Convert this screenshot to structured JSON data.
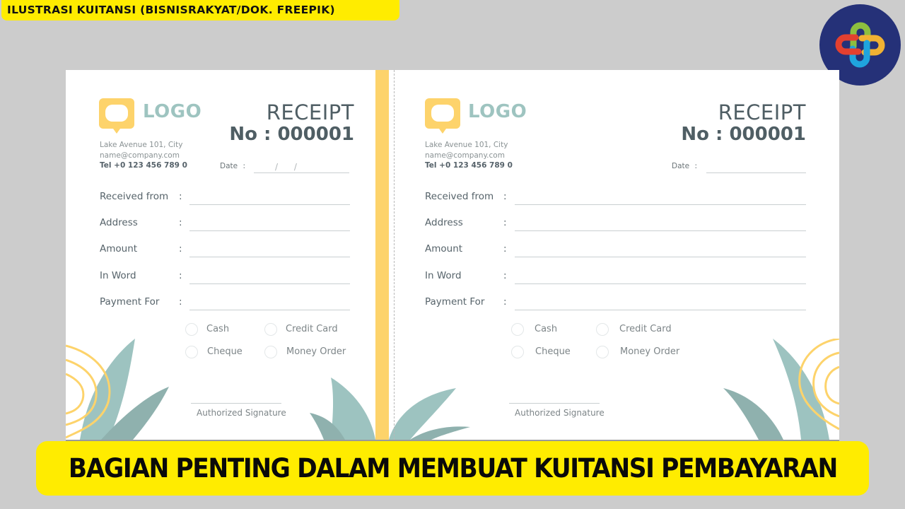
{
  "caption": "ILUSTRASI KUITANSI (BISNISRAKYAT/DOK. FREEPIK)",
  "headline": "BAGIAN PENTING DALAM MEMBUAT KUITANSI PEMBAYARAN",
  "brand_logo": {
    "icon": "interlocking-chain-logo",
    "colors": [
      "#253178",
      "#8dbf3f",
      "#f1b233",
      "#1fa4de",
      "#e3402f"
    ]
  },
  "colors": {
    "accent_yellow": "#fdd36b",
    "logo_teal": "#9ec4c0",
    "text_dark": "#4f5e64",
    "leaf": "#9dc3c0"
  },
  "receipts": [
    {
      "logo_text": "LOGO",
      "address": "Lake Avenue 101, City",
      "email": "name@company.com",
      "tel": "Tel +0 123 456 789 0",
      "title": "RECEIPT",
      "number": "No : 000001",
      "date_label": "Date",
      "date_sep": ":",
      "date_value": "/      /",
      "fields": [
        {
          "label": "Received from",
          "colon": ":",
          "value": ""
        },
        {
          "label": "Address",
          "colon": ":",
          "value": ""
        },
        {
          "label": "Amount",
          "colon": ":",
          "value": ""
        },
        {
          "label": "In Word",
          "colon": ":",
          "value": ""
        },
        {
          "label": "Payment For",
          "colon": ":",
          "value": ""
        }
      ],
      "payment_options": [
        "Cash",
        "Credit Card",
        "Cheque",
        "Money Order"
      ],
      "signature_label": "Authorized Signature"
    },
    {
      "logo_text": "LOGO",
      "address": "Lake Avenue 101, City",
      "email": "name@company.com",
      "tel": "Tel +0 123 456 789 0",
      "title": "RECEIPT",
      "number": "No : 000001",
      "date_label": "Date",
      "date_sep": ":",
      "date_value": "",
      "fields": [
        {
          "label": "Received from",
          "colon": ":",
          "value": ""
        },
        {
          "label": "Address",
          "colon": ":",
          "value": ""
        },
        {
          "label": "Amount",
          "colon": ":",
          "value": ""
        },
        {
          "label": "In Word",
          "colon": ":",
          "value": ""
        },
        {
          "label": "Payment For",
          "colon": ":",
          "value": ""
        }
      ],
      "payment_options": [
        "Cash",
        "Credit Card",
        "Cheque",
        "Money Order"
      ],
      "signature_label": "Authorized Signature"
    }
  ]
}
